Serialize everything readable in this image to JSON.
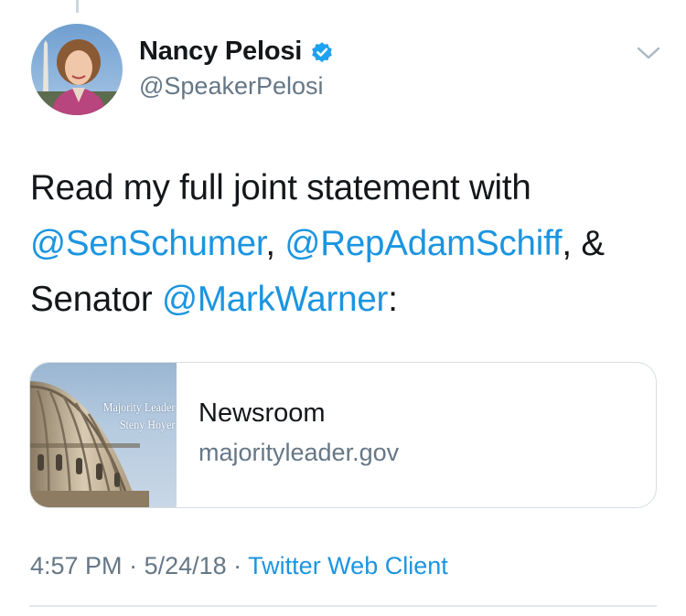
{
  "author": {
    "name": "Nancy Pelosi",
    "handle": "@SpeakerPelosi",
    "verified_icon": "verified-badge-icon",
    "accent_color": "#1da1f2"
  },
  "tweet": {
    "text_1": "Read my full joint statement with",
    "mention_1": "@SenSchumer",
    "sep_1": ", ",
    "mention_2": "@RepAdamSchiff",
    "sep_2": ", &",
    "text_2": "Senator ",
    "mention_3": "@MarkWarner",
    "text_3": ":"
  },
  "card": {
    "thumbnail_line_1": "Majority Leader",
    "thumbnail_line_2": "Steny Hoyer",
    "title": "Newsroom",
    "domain": "majorityleader.gov"
  },
  "meta": {
    "time": "4:57 PM",
    "dot_1": " · ",
    "date": "5/24/18",
    "dot_2": " · ",
    "source": "Twitter Web Client"
  },
  "colors": {
    "link": "#1b95e0",
    "secondary_text": "#657786",
    "primary_text": "#14171a",
    "border": "#e1e8ed"
  }
}
